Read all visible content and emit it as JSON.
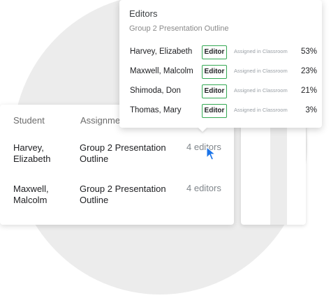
{
  "table": {
    "headers": {
      "student": "Student",
      "assignment": "Assignme"
    },
    "rows": [
      {
        "student_line1": "Harvey,",
        "student_line2": "Elizabeth",
        "assignment_line1": "Group 2 Presentation",
        "assignment_line2": "Outline",
        "editors": "4 editors"
      },
      {
        "student_line1": "Maxwell,",
        "student_line2": "Malcolm",
        "assignment_line1": "Group 2 Presentation",
        "assignment_line2": "Outline",
        "editors": "4 editors"
      }
    ]
  },
  "popup": {
    "title": "Editors",
    "subtitle": "Group 2 Presentation Outline",
    "editors": [
      {
        "name": "Harvey, Elizabeth",
        "role": "Editor",
        "source": "Assigned in Classroom",
        "percent": "53%"
      },
      {
        "name": "Maxwell, Malcolm",
        "role": "Editor",
        "source": "Assigned in Classroom",
        "percent": "23%"
      },
      {
        "name": "Shimoda, Don",
        "role": "Editor",
        "source": "Assigned in Classroom",
        "percent": "21%"
      },
      {
        "name": "Thomas, Mary",
        "role": "Editor",
        "source": "Assigned in Classroom",
        "percent": "3%"
      }
    ]
  },
  "colors": {
    "badge_border": "#34a853",
    "cursor": "#1a73e8"
  },
  "icons": {
    "cursor": "mouse-pointer-icon"
  }
}
